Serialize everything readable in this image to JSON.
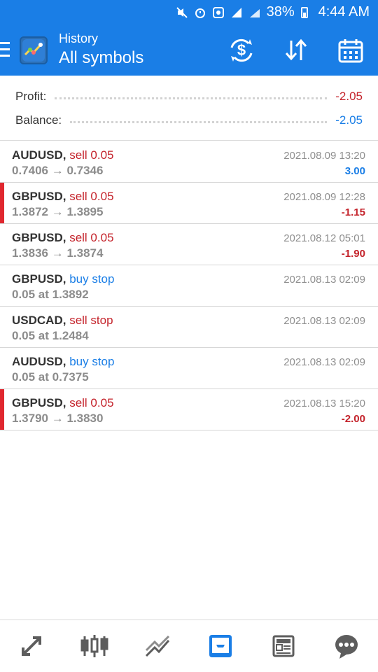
{
  "status_bar": {
    "battery": "38%",
    "time": "4:44 AM"
  },
  "header": {
    "subtitle": "History",
    "title": "All symbols"
  },
  "summary": {
    "profit_label": "Profit:",
    "profit_value": "-2.05",
    "balance_label": "Balance:",
    "balance_value": "-2.05"
  },
  "colors": {
    "primary": "#1a7ee6",
    "sell": "#c4232b",
    "buy": "#1a7ee6",
    "indicator": "#e0272f"
  },
  "rows": [
    {
      "symbol": "AUDUSD,",
      "side": "sell 0.05",
      "side_type": "sell",
      "detail": "0.7406 → 0.7346",
      "time": "2021.08.09 13:20",
      "profit": "3.00",
      "profit_type": "pos",
      "flag": false
    },
    {
      "symbol": "GBPUSD,",
      "side": "sell 0.05",
      "side_type": "sell",
      "detail": "1.3872 → 1.3895",
      "time": "2021.08.09 12:28",
      "profit": "-1.15",
      "profit_type": "neg",
      "flag": true
    },
    {
      "symbol": "GBPUSD,",
      "side": "sell 0.05",
      "side_type": "sell",
      "detail": "1.3836 → 1.3874",
      "time": "2021.08.12 05:01",
      "profit": "-1.90",
      "profit_type": "neg",
      "flag": false
    },
    {
      "symbol": "GBPUSD,",
      "side": "buy stop",
      "side_type": "buy",
      "detail": "0.05 at 1.3892",
      "time": "2021.08.13 02:09",
      "profit": "",
      "profit_type": "",
      "flag": false
    },
    {
      "symbol": "USDCAD,",
      "side": "sell stop",
      "side_type": "sell",
      "detail": "0.05 at 1.2484",
      "time": "2021.08.13 02:09",
      "profit": "",
      "profit_type": "",
      "flag": false
    },
    {
      "symbol": "AUDUSD,",
      "side": "buy stop",
      "side_type": "buy",
      "detail": "0.05 at 0.7375",
      "time": "2021.08.13 02:09",
      "profit": "",
      "profit_type": "",
      "flag": false
    },
    {
      "symbol": "GBPUSD,",
      "side": "sell 0.05",
      "side_type": "sell",
      "detail": "1.3790 → 1.3830",
      "time": "2021.08.13 15:20",
      "profit": "-2.00",
      "profit_type": "neg",
      "flag": true
    }
  ],
  "bottom_nav": [
    {
      "name": "quotes-icon"
    },
    {
      "name": "chart-icon"
    },
    {
      "name": "trade-icon"
    },
    {
      "name": "history-icon",
      "active": true
    },
    {
      "name": "news-icon"
    },
    {
      "name": "chat-icon"
    }
  ]
}
